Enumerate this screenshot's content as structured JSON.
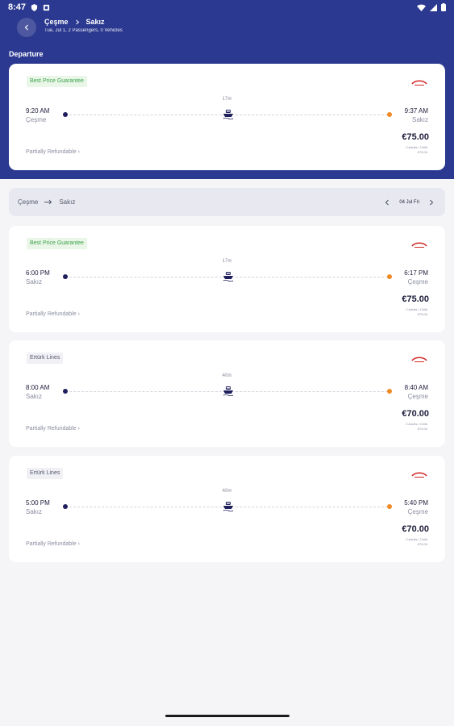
{
  "status": {
    "time": "8:47"
  },
  "header": {
    "from": "Çeşme",
    "to": "Sakız",
    "subtitle": "Tue, Jul 1, 2 Passengers, 0 Vehicles"
  },
  "section_title": "Departure",
  "selected": {
    "badge": "Best Price Guarantee",
    "duration": "17m",
    "dep_time": "9:20 AM",
    "dep_place": "Çeşme",
    "arr_time": "9:37 AM",
    "arr_place": "Sakız",
    "price": "€75.00",
    "fare_line1": "2 Adults / Child",
    "fare_line2": "€75.00",
    "refund": "Partially Refundable",
    "refund_chevron": "›"
  },
  "datebar": {
    "from": "Çeşme",
    "to": "Sakız",
    "date": "04 Jul Fri"
  },
  "trips": [
    {
      "badge": "Best Price Guarantee",
      "duration": "17m",
      "dep_time": "6:00 PM",
      "dep_place": "Sakız",
      "arr_time": "6:17 PM",
      "arr_place": "Çeşme",
      "price": "€75.00",
      "fare_line1": "2 Adults / Child",
      "fare_line2": "€75.00",
      "refund": "Partially Refundable",
      "refund_chevron": "›"
    },
    {
      "badge": "Ertürk Lines",
      "duration": "40m",
      "dep_time": "8:00 AM",
      "dep_place": "Sakız",
      "arr_time": "8:40 AM",
      "arr_place": "Çeşme",
      "price": "€70.00",
      "fare_line1": "2 Adults / Child",
      "fare_line2": "€70.00",
      "refund": "Partially Refundable",
      "refund_chevron": "›"
    },
    {
      "badge": "Ertürk Lines",
      "duration": "40m",
      "dep_time": "5:00 PM",
      "dep_place": "Sakız",
      "arr_time": "5:40 PM",
      "arr_place": "Çeşme",
      "price": "€70.00",
      "fare_line1": "2 Adults / Child",
      "fare_line2": "€70.00",
      "refund": "Partially Refundable",
      "refund_chevron": "›"
    }
  ],
  "colors": {
    "brand": "#2b3990",
    "badge_green": "#3ba34a",
    "start_dot": "#1f1f5e",
    "end_dot": "#f08a24"
  },
  "icons": {
    "back": "chevron-left-icon",
    "ferry": "ferry-icon",
    "logo": "operator-logo-icon"
  }
}
